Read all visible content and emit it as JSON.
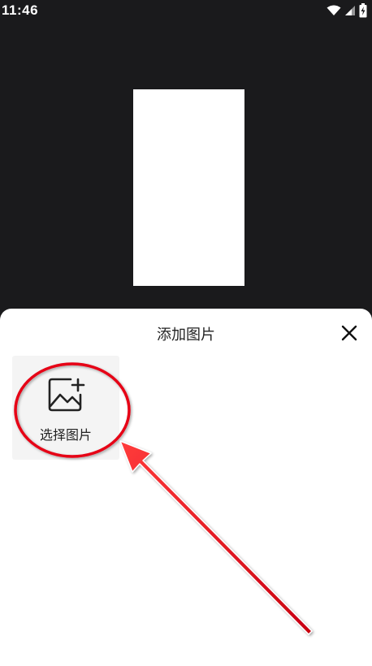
{
  "status_bar": {
    "time": "11:46",
    "icons": [
      "wifi-icon",
      "signal-icon",
      "battery-charging-icon"
    ]
  },
  "sheet": {
    "title": "添加图片",
    "close_icon": "close-icon",
    "tile": {
      "label": "选择图片",
      "icon": "add-image-icon"
    }
  },
  "colors": {
    "background": "#1a1a1c",
    "sheet": "#ffffff",
    "tile": "#f4f4f4",
    "annotation": "#e60012"
  }
}
